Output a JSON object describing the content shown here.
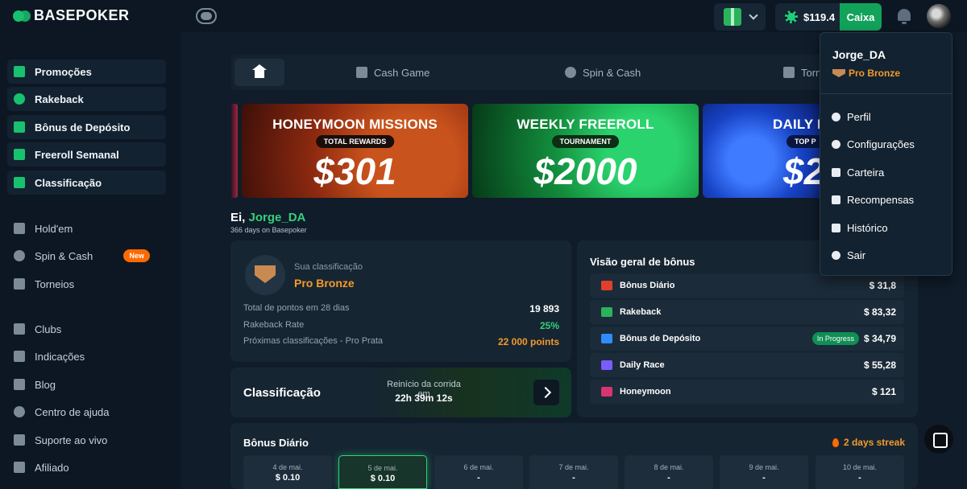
{
  "header": {
    "brand": "BASEPOKER",
    "balance": "$119.4",
    "cashier_label": "Caixa"
  },
  "sidebar": {
    "items": [
      {
        "label": "Promoções",
        "icon": "gift-icon"
      },
      {
        "label": "Rakeback",
        "icon": "coins-icon"
      },
      {
        "label": "Bônus de Depósito",
        "icon": "cash-icon"
      },
      {
        "label": "Freeroll Semanal",
        "icon": "ticket-icon"
      },
      {
        "label": "Classificação",
        "icon": "podium-icon"
      },
      {
        "label": "Hold'em",
        "icon": "cards-icon"
      },
      {
        "label": "Spin & Cash",
        "icon": "spin-icon",
        "badge": "New"
      },
      {
        "label": "Torneios",
        "icon": "trophy-icon"
      },
      {
        "label": "Clubs",
        "icon": "home-icon"
      },
      {
        "label": "Indicações",
        "icon": "referral-icon"
      },
      {
        "label": "Blog",
        "icon": "news-icon"
      },
      {
        "label": "Centro de ajuda",
        "icon": "lifebuoy-icon"
      },
      {
        "label": "Suporte ao vivo",
        "icon": "chat-icon"
      },
      {
        "label": "Afiliado",
        "icon": "affiliate-icon"
      }
    ]
  },
  "tabs": [
    {
      "label": "Cash Game"
    },
    {
      "label": "Spin & Cash"
    },
    {
      "label": "Torn"
    }
  ],
  "banners": [
    {
      "title": "HONEYMOON MISSIONS",
      "subtitle": "TOTAL REWARDS",
      "amount": "$301"
    },
    {
      "title": "WEEKLY FREEROLL",
      "subtitle": "TOURNAMENT",
      "amount": "$2000"
    },
    {
      "title": "DAILY B",
      "subtitle": "TOP P",
      "amount": "$2"
    }
  ],
  "greeting": {
    "prefix": "Ei,",
    "name": "Jorge_DA",
    "sub": "366 days on Basepoker"
  },
  "rank": {
    "label": "Sua classificação",
    "value": "Pro Bronze",
    "stats": [
      {
        "k": "Total de pontos em 28 dias",
        "v": "19 893"
      },
      {
        "k": "Rakeback Rate",
        "v": "25%"
      },
      {
        "k": "Próximas classificações - Pro Prata",
        "v": "22 000 points"
      }
    ]
  },
  "race": {
    "title": "Classificação",
    "label": "Reinício da corrida em",
    "value": "22h 39m 12s"
  },
  "bonus_overview": {
    "title": "Visão geral de bônus",
    "rows": [
      {
        "label": "Bônus Diário",
        "value": "$ 31,8",
        "color": "#e0402a"
      },
      {
        "label": "Rakeback",
        "value": "$ 83,32",
        "color": "#2bb35c"
      },
      {
        "label": "Bônus de Depósito",
        "value": "$ 34,79",
        "color": "#2f8cff",
        "status": "In Progress"
      },
      {
        "label": "Daily Race",
        "value": "$ 55,28",
        "color": "#7a5cff"
      },
      {
        "label": "Honeymoon",
        "value": "$ 121",
        "color": "#d8356e"
      }
    ]
  },
  "daily_bonus": {
    "title": "Bônus Diário",
    "streak": "2 days streak",
    "days": [
      {
        "date": "4 de mai.",
        "amount": "$ 0.10"
      },
      {
        "date": "5 de mai.",
        "amount": "$ 0.10",
        "active": true
      },
      {
        "date": "6 de mai.",
        "amount": "-"
      },
      {
        "date": "7 de mai.",
        "amount": "-"
      },
      {
        "date": "8 de mai.",
        "amount": "-"
      },
      {
        "date": "9 de mai.",
        "amount": "-"
      },
      {
        "date": "10 de mai.",
        "amount": "-"
      }
    ]
  },
  "user_menu": {
    "username": "Jorge_DA",
    "rank": "Pro Bronze",
    "items": [
      {
        "label": "Perfil",
        "icon": "user-icon"
      },
      {
        "label": "Configurações",
        "icon": "gear-icon"
      },
      {
        "label": "Carteira",
        "icon": "wallet-icon"
      },
      {
        "label": "Recompensas",
        "icon": "gift-icon"
      },
      {
        "label": "Histórico",
        "icon": "document-icon"
      },
      {
        "label": "Sair",
        "icon": "logout-icon"
      }
    ]
  }
}
